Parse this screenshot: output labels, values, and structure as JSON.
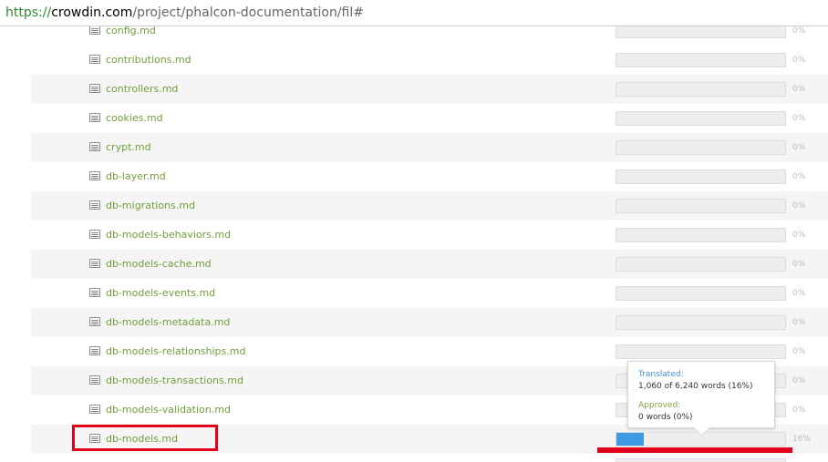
{
  "browser": {
    "url_scheme": "https://",
    "url_domain": "crowdin.com",
    "url_path": "/project/phalcon-documentation/fil#"
  },
  "files": [
    {
      "name": "config.md",
      "progress": 0,
      "percent_label": "0%"
    },
    {
      "name": "contributions.md",
      "progress": 0,
      "percent_label": "0%"
    },
    {
      "name": "controllers.md",
      "progress": 0,
      "percent_label": "0%"
    },
    {
      "name": "cookies.md",
      "progress": 0,
      "percent_label": "0%"
    },
    {
      "name": "crypt.md",
      "progress": 0,
      "percent_label": "0%"
    },
    {
      "name": "db-layer.md",
      "progress": 0,
      "percent_label": "0%"
    },
    {
      "name": "db-migrations.md",
      "progress": 0,
      "percent_label": "0%"
    },
    {
      "name": "db-models-behaviors.md",
      "progress": 0,
      "percent_label": "0%"
    },
    {
      "name": "db-models-cache.md",
      "progress": 0,
      "percent_label": "0%"
    },
    {
      "name": "db-models-events.md",
      "progress": 0,
      "percent_label": "0%"
    },
    {
      "name": "db-models-metadata.md",
      "progress": 0,
      "percent_label": "0%"
    },
    {
      "name": "db-models-relationships.md",
      "progress": 0,
      "percent_label": "0%"
    },
    {
      "name": "db-models-transactions.md",
      "progress": 0,
      "percent_label": "0%"
    },
    {
      "name": "db-models-validation.md",
      "progress": 0,
      "percent_label": "0%"
    },
    {
      "name": "db-models.md",
      "progress": 0.16,
      "percent_label": "16%"
    }
  ],
  "tooltip": {
    "translated_label": "Translated:",
    "translated_value": "1,060 of 6,240 words (16%)",
    "approved_label": "Approved:",
    "approved_value": "0 words (0%)"
  },
  "colors": {
    "file_link": "#6f9f3a",
    "progress_fill": "#3e9be4",
    "highlight": "#e3001b",
    "stripe": "#f5f5f5"
  }
}
